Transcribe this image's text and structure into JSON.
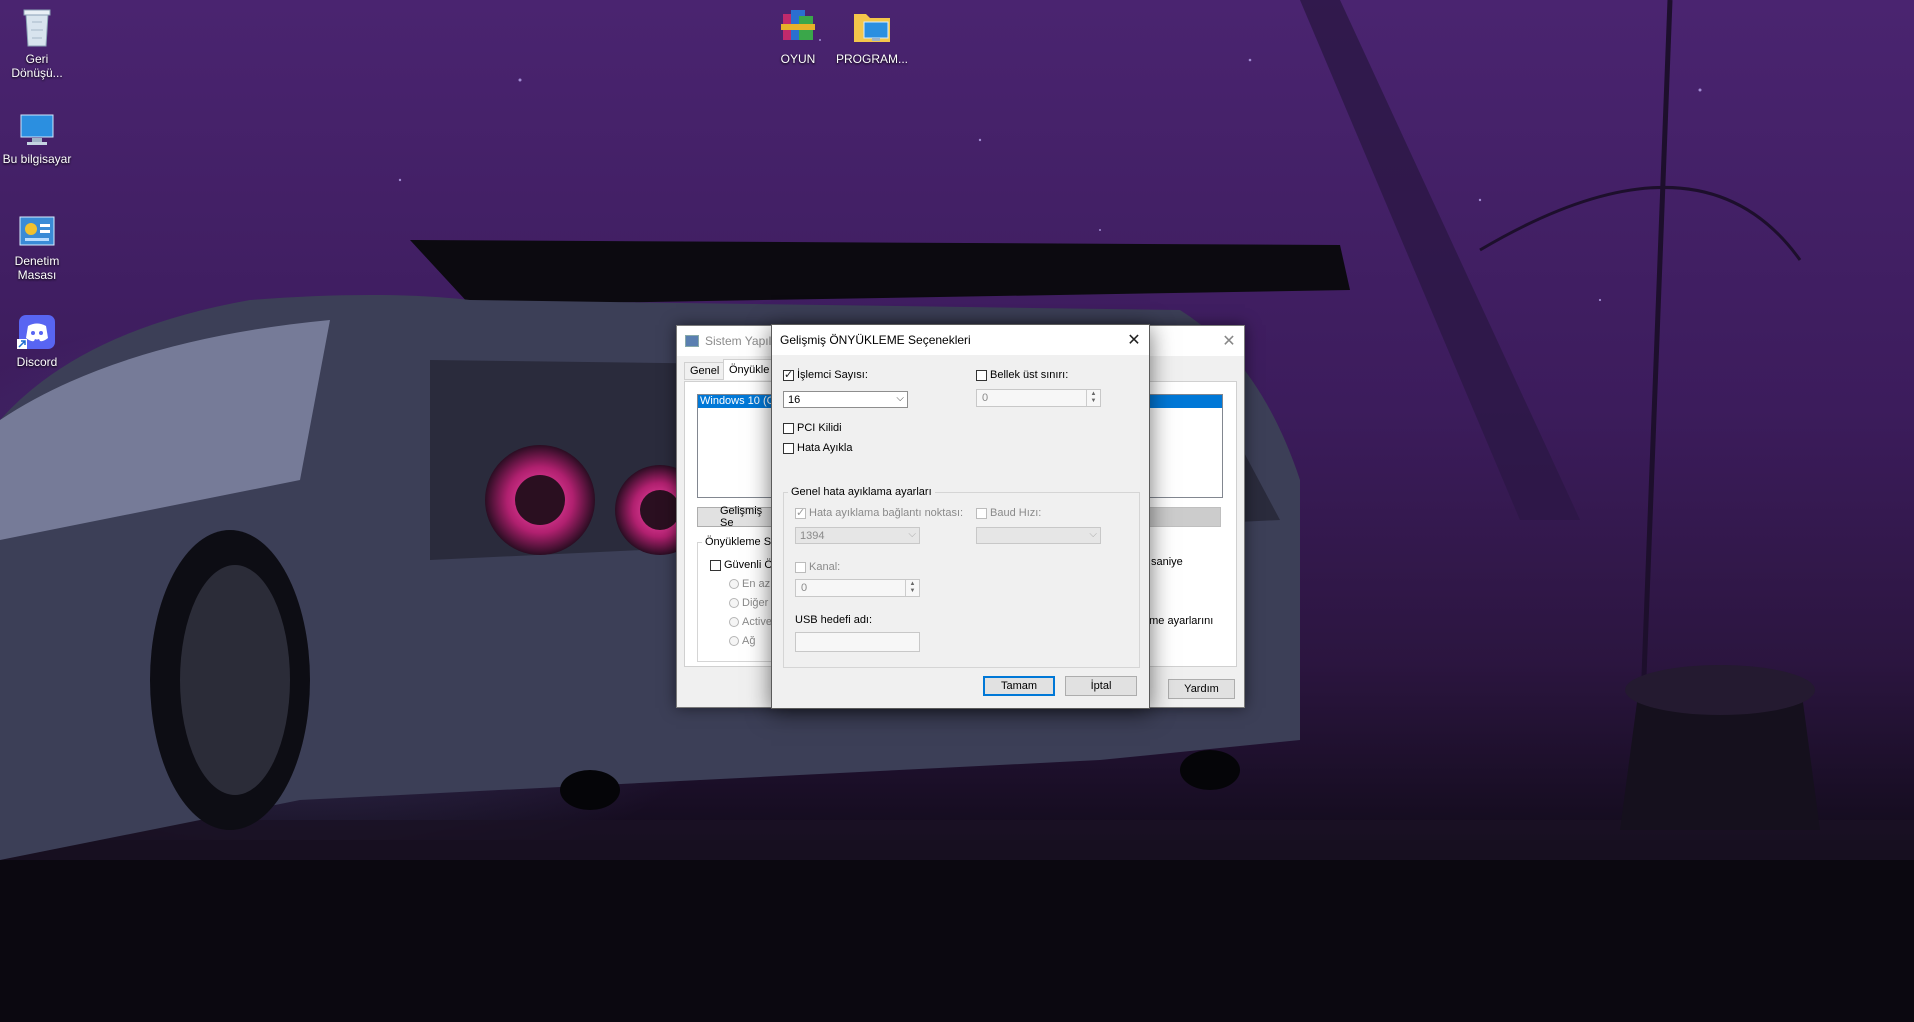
{
  "desktop": {
    "icons": [
      {
        "label": "Geri Dönüşü..."
      },
      {
        "label": "Bu bilgisayar"
      },
      {
        "label": "Denetim Masası"
      },
      {
        "label": "Discord"
      },
      {
        "label": "OYUN"
      },
      {
        "label": "PROGRAM..."
      }
    ]
  },
  "bg_window": {
    "title": "Sistem Yapıla",
    "tabs": [
      "Genel",
      "Önyükle"
    ],
    "list_item": "Windows 10 (C",
    "advanced_button": "Gelişmiş Se",
    "boot_options_label": "Önyükleme Se",
    "safe_boot": "Güvenli Ö",
    "radios": [
      "En az",
      "Diğer",
      "Active",
      "Ağ"
    ],
    "right_text_1": "saniye",
    "right_text_2": "eme ayarlarını",
    "help_button": "Yardım"
  },
  "dialog": {
    "title": "Gelişmiş ÖNYÜKLEME Seçenekleri",
    "processor_count_label": "İşlemci Sayısı:",
    "processor_count_value": "16",
    "max_memory_label": "Bellek üst sınırı:",
    "max_memory_value": "0",
    "pci_lock_label": "PCI Kilidi",
    "debug_label": "Hata Ayıkla",
    "debug_group_label": "Genel hata ayıklama ayarları",
    "debug_port_label": "Hata ayıklama bağlantı noktası:",
    "debug_port_value": "1394",
    "baud_rate_label": "Baud Hızı:",
    "baud_rate_value": "",
    "channel_label": "Kanal:",
    "channel_value": "0",
    "usb_target_label": "USB hedefi adı:",
    "usb_target_value": "",
    "ok_button": "Tamam",
    "cancel_button": "İptal"
  }
}
